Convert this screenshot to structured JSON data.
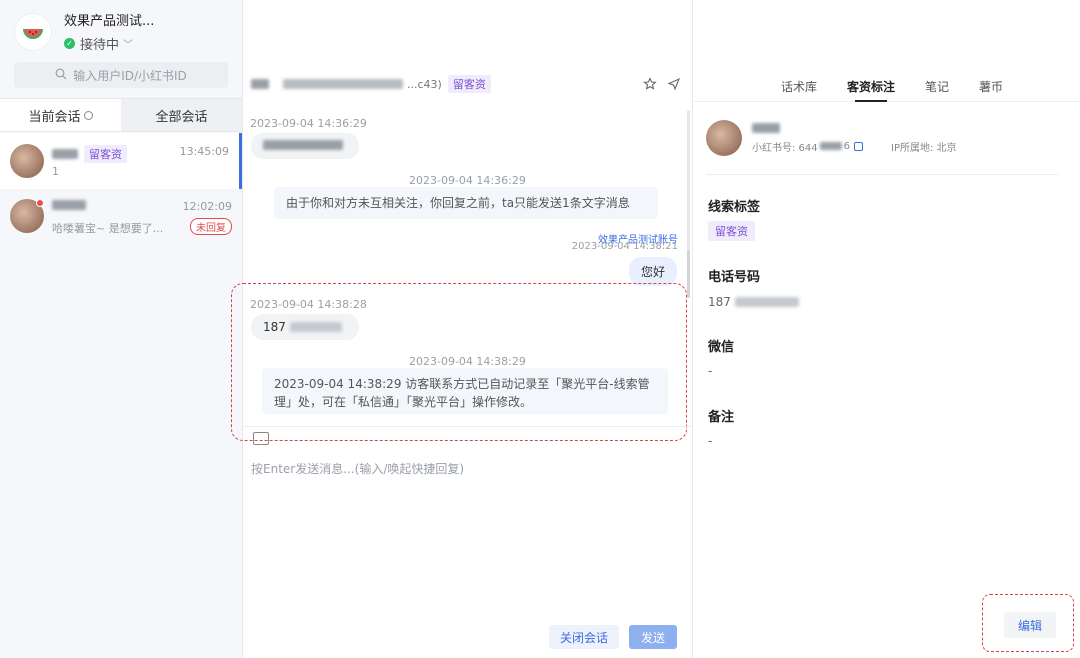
{
  "window": {
    "controls": [
      "feedback-icon",
      "minimize-icon",
      "maximize-icon",
      "close-icon"
    ]
  },
  "sidebar": {
    "shop_name": "效果产品测试...",
    "status": "接待中",
    "search_placeholder": "输入用户ID/小红书ID",
    "tabs": [
      {
        "label": "当前会话",
        "active": true
      },
      {
        "label": "全部会话",
        "active": false
      }
    ],
    "conversations": [
      {
        "tag": "留客资",
        "preview": "1",
        "time": "13:45:09",
        "selected": true,
        "badge": "",
        "unread_dot": false
      },
      {
        "tag": "",
        "preview": "哈喽薯宝~ 是想要了...",
        "time": "12:02:09",
        "selected": false,
        "badge": "未回复",
        "unread_dot": true
      }
    ]
  },
  "chat": {
    "header": {
      "user_id_suffix": "...c43)",
      "tag": "留客资"
    },
    "messages": {
      "m1": {
        "time": "2023-09-04 14:36:29"
      },
      "m2": {
        "time": "2023-09-04 14:36:29",
        "text": "由于你和对方未互相关注，你回复之前，ta只能发送1条文字消息"
      },
      "m3": {
        "sender": "效果产品测试账号",
        "time": "2023-09-04 14:38:21",
        "text": "您好"
      },
      "m4": {
        "time": "2023-09-04 14:38:28",
        "text": "187"
      },
      "m5": {
        "time": "2023-09-04 14:38:29",
        "text": "2023-09-04 14:38:29 访客联系方式已自动记录至「聚光平台-线索管理」处，可在「私信通」「聚光平台」操作修改。"
      }
    },
    "input_placeholder": "按Enter发送消息...(输入/唤起快捷回复)",
    "close_label": "关闭会话",
    "send_label": "发送"
  },
  "right_panel": {
    "tabs": [
      {
        "label": "话术库",
        "active": false
      },
      {
        "label": "客资标注",
        "active": true
      },
      {
        "label": "笔记",
        "active": false
      },
      {
        "label": "薯币",
        "active": false
      }
    ],
    "profile": {
      "xhs_label": "小红书号: 644",
      "xhs_suffix": "6",
      "ip_label": "IP所属地: 北京"
    },
    "fields": {
      "lead_tag_label": "线索标签",
      "lead_tag_value": "留客资",
      "phone_label": "电话号码",
      "phone_value": "187",
      "wechat_label": "微信",
      "wechat_value": "-",
      "note_label": "备注",
      "note_value": "-"
    },
    "edit_label": "编辑"
  },
  "colors": {
    "accent": "#3b6ee0",
    "purple_tag": "#7a4fd6",
    "highlight": "#d64545",
    "online": "#2bbf6b"
  }
}
